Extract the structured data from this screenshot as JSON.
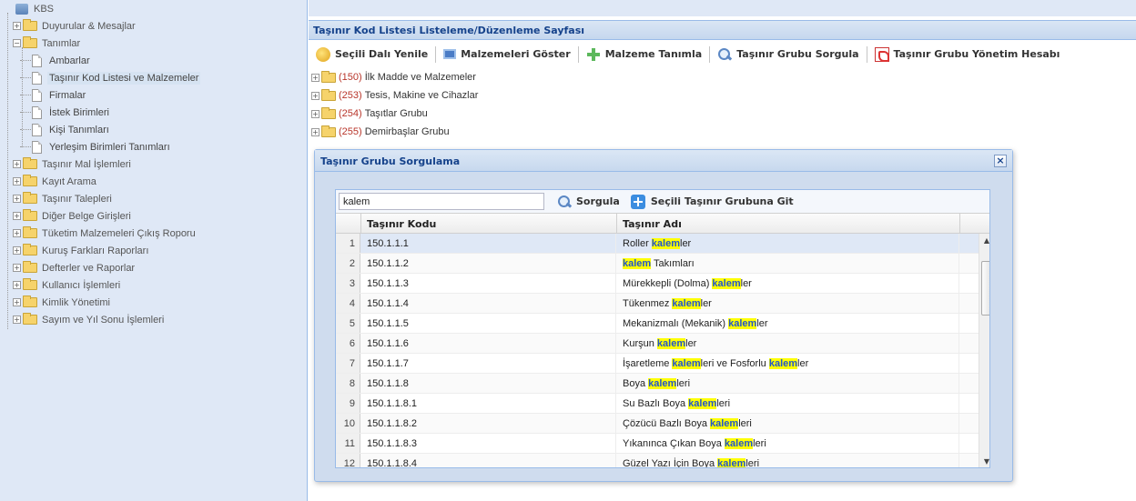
{
  "left_tree": {
    "root": "KBS",
    "items": [
      {
        "label": "Duyurular & Mesajlar",
        "type": "folder",
        "exp": "+"
      },
      {
        "label": "Tanımlar",
        "type": "folder",
        "exp": "−"
      },
      {
        "label": "Ambarlar",
        "type": "leaf"
      },
      {
        "label": "Taşınır Kod Listesi ve Malzemeler",
        "type": "leaf",
        "selected": true
      },
      {
        "label": "Firmalar",
        "type": "leaf"
      },
      {
        "label": "İstek Birimleri",
        "type": "leaf"
      },
      {
        "label": "Kişi Tanımları",
        "type": "leaf"
      },
      {
        "label": "Yerleşim Birimleri Tanımları",
        "type": "leaf"
      },
      {
        "label": "Taşınır Mal İşlemleri",
        "type": "folder",
        "exp": "+"
      },
      {
        "label": "Kayıt Arama",
        "type": "folder",
        "exp": "+"
      },
      {
        "label": "Taşınır Talepleri",
        "type": "folder",
        "exp": "+"
      },
      {
        "label": "Diğer Belge Girişleri",
        "type": "folder",
        "exp": "+"
      },
      {
        "label": "Tüketim Malzemeleri Çıkış Roporu",
        "type": "folder",
        "exp": "+"
      },
      {
        "label": "Kuruş Farkları Raporları",
        "type": "folder",
        "exp": "+"
      },
      {
        "label": "Defterler ve Raporlar",
        "type": "folder",
        "exp": "+"
      },
      {
        "label": "Kullanıcı İşlemleri",
        "type": "folder",
        "exp": "+"
      },
      {
        "label": "Kimlik Yönetimi",
        "type": "folder",
        "exp": "+"
      },
      {
        "label": "Sayım ve Yıl Sonu İşlemleri",
        "type": "folder",
        "exp": "+"
      }
    ]
  },
  "panel": {
    "title": "Taşınır Kod Listesi Listeleme/Düzenleme Sayfası"
  },
  "toolbar": {
    "refresh": "Seçili Dalı Yenile",
    "show_materials": "Malzemeleri Göster",
    "define_material": "Malzeme Tanımla",
    "query_group": "Taşınır Grubu Sorgula",
    "group_account": "Taşınır Grubu Yönetim Hesabı"
  },
  "main_tree": [
    {
      "exp": "+",
      "code": "(150)",
      "label": "İlk Madde ve Malzemeler"
    },
    {
      "exp": "+",
      "code": "(253)",
      "label": "Tesis, Makine ve Cihazlar"
    },
    {
      "exp": "+",
      "code": "(254)",
      "label": "Taşıtlar Grubu"
    },
    {
      "exp": "+",
      "code": "(255)",
      "label": "Demirbaşlar Grubu"
    }
  ],
  "dialog": {
    "title": "Taşınır Grubu Sorgulama",
    "close": "×",
    "search_value": "kalem",
    "search_button": "Sorgula",
    "goto_button": "Seçili Taşınır Grubuna Git",
    "columns": {
      "code": "Taşınır Kodu",
      "name": "Taşınır Adı"
    },
    "highlight_term": "kalem",
    "rows": [
      {
        "num": "1",
        "code": "150.1.1.1",
        "name": "Roller kalemler"
      },
      {
        "num": "2",
        "code": "150.1.1.2",
        "name": "kalem Takımları"
      },
      {
        "num": "3",
        "code": "150.1.1.3",
        "name": "Mürekkepli (Dolma) kalemler"
      },
      {
        "num": "4",
        "code": "150.1.1.4",
        "name": "Tükenmez kalemler"
      },
      {
        "num": "5",
        "code": "150.1.1.5",
        "name": "Mekanizmalı (Mekanik) kalemler"
      },
      {
        "num": "6",
        "code": "150.1.1.6",
        "name": "Kurşun kalemler"
      },
      {
        "num": "7",
        "code": "150.1.1.7",
        "name": "İşaretleme kalemleri ve Fosforlu kalemler"
      },
      {
        "num": "8",
        "code": "150.1.1.8",
        "name": "Boya kalemleri"
      },
      {
        "num": "9",
        "code": "150.1.1.8.1",
        "name": "Su Bazlı Boya kalemleri"
      },
      {
        "num": "10",
        "code": "150.1.1.8.2",
        "name": "Çözücü Bazlı Boya kalemleri"
      },
      {
        "num": "11",
        "code": "150.1.1.8.3",
        "name": "Yıkanınca Çıkan Boya kalemleri"
      },
      {
        "num": "12",
        "code": "150.1.1.8.4",
        "name": "Güzel Yazı İçin Boya kalemleri"
      }
    ]
  },
  "colors": {
    "panel_bg": "#dfe8f6",
    "header_text": "#15428b",
    "highlight_bg": "#ffff00",
    "highlight_text": "#2255cc",
    "code_text": "#b8352a"
  }
}
